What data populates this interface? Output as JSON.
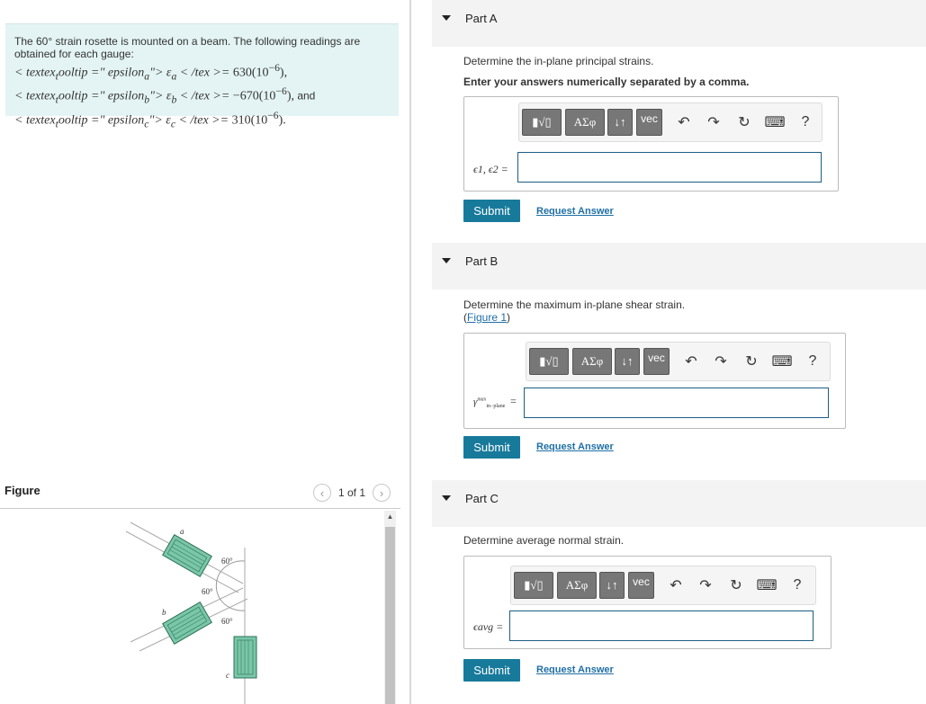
{
  "problem": {
    "intro": "The 60° strain rosette is mounted on a beam. The following readings are obtained for each gauge:",
    "readings": [
      {
        "prefix": "< textex",
        "sub1": "t",
        "mid": "ooltip =\" epsilon",
        "sub2": "a",
        "mid2": "\"> ε",
        "sub3": "a",
        "tail": " < /tex >= ",
        "value": "630(10",
        "exp": "−6",
        "close": "),"
      },
      {
        "prefix": "< textex",
        "sub1": "t",
        "mid": "ooltip =\" epsilon",
        "sub2": "b",
        "mid2": "\"> ε",
        "sub3": "b",
        "tail": " < /tex >= ",
        "value": "−670(10",
        "exp": "−6",
        "close": "),",
        "and": " and"
      },
      {
        "prefix": "< textex",
        "sub1": "t",
        "mid": "ooltip =\" epsilon",
        "sub2": "c",
        "mid2": "\"> ε",
        "sub3": "c",
        "tail": " < /tex >= ",
        "value": "310(10",
        "exp": "−6",
        "close": ")."
      }
    ]
  },
  "figure": {
    "title": "Figure",
    "counter": "1 of 1",
    "labels": {
      "a": "a",
      "b": "b",
      "c": "c",
      "angle": "60°"
    }
  },
  "parts": [
    {
      "title": "Part A",
      "question": "Determine the in-plane principal strains.",
      "instruction": "Enter your answers numerically separated by a comma.",
      "label": "ϵ1, ϵ2 =",
      "submit": "Submit",
      "request": "Request Answer"
    },
    {
      "title": "Part B",
      "question": "Determine the maximum in-plane shear strain.",
      "figure_link": "Figure 1",
      "label_sym": "γ",
      "label_sup": "max",
      "label_sub": "in−plane",
      "label_eq": "=",
      "submit": "Submit",
      "request": "Request Answer"
    },
    {
      "title": "Part C",
      "question": "Determine average normal strain.",
      "label": "ϵavg =",
      "submit": "Submit",
      "request": "Request Answer"
    }
  ],
  "toolbar": {
    "templates": "▮√▯",
    "greek": "ΑΣφ",
    "arrows": "↓↑",
    "vec": "vec",
    "help": "?"
  },
  "colors": {
    "accent": "#187a9b",
    "problem_bg": "#e4f4f4",
    "gauge": "#79c7a8"
  }
}
